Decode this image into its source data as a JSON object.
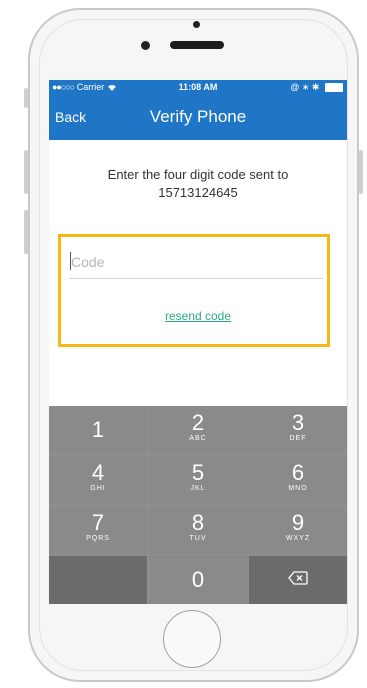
{
  "status_bar": {
    "signal": "●●○○○",
    "carrier": "Carrier",
    "wifi_icon": "wifi-icon",
    "time": "11:08 AM",
    "right_icons": "@ ∗ ✱"
  },
  "nav": {
    "back_label": "Back",
    "title": "Verify Phone"
  },
  "prompt": {
    "line1": "Enter the four digit code sent to",
    "phone_number": "15713124645"
  },
  "code_field": {
    "placeholder": "Code",
    "value": ""
  },
  "resend_label": "resend code",
  "colors": {
    "nav_blue": "#1f76c6",
    "highlight_yellow": "#f4b818",
    "link_green": "#2daa87",
    "keypad_gray": "#8a8a8a",
    "keypad_dark": "#6b6b6b"
  },
  "keypad": {
    "k1": {
      "digit": "1",
      "letters": ""
    },
    "k2": {
      "digit": "2",
      "letters": "ABC"
    },
    "k3": {
      "digit": "3",
      "letters": "DEF"
    },
    "k4": {
      "digit": "4",
      "letters": "GHI"
    },
    "k5": {
      "digit": "5",
      "letters": "JKL"
    },
    "k6": {
      "digit": "6",
      "letters": "MNO"
    },
    "k7": {
      "digit": "7",
      "letters": "PQRS"
    },
    "k8": {
      "digit": "8",
      "letters": "TUV"
    },
    "k9": {
      "digit": "9",
      "letters": "WXYZ"
    },
    "k0": {
      "digit": "0",
      "letters": ""
    },
    "delete_icon": "backspace-icon"
  }
}
